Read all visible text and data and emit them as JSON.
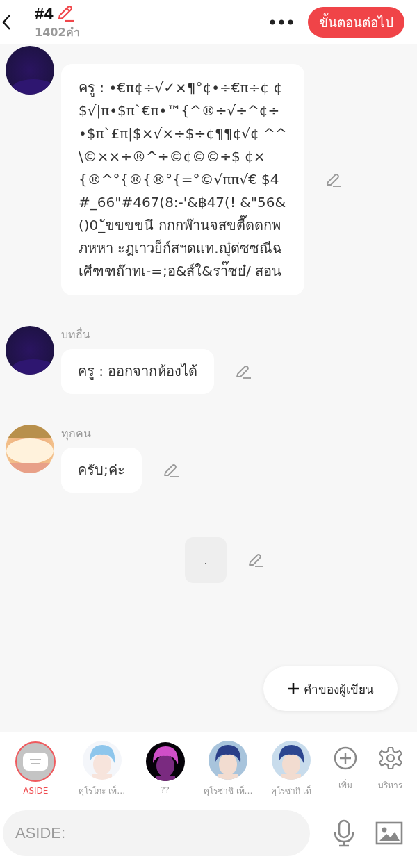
{
  "header": {
    "title": "#4",
    "word_count": "1402คำ",
    "next_button": "ขั้นตอนต่อไป"
  },
  "messages": [
    {
      "kind": "message",
      "text": "ครู : •€π¢÷√✓×¶°¢•÷€π÷¢ ¢$√|π•$π`€π•™{^®÷√÷^¢÷ •$π`£π|$×√×÷$÷¢¶¶¢√¢ ^^\\©××÷®^÷©¢©©÷$ ¢×{®^°{®{®°{=°©√ππ√€ $4#_66\"#467(8:-'&฿47(! &\"56&()0_ัขขขขนึ กกกพ๊านจสขตื๊ดดกพภหหา ะฎเาวย็ก์สฯดแท.ญุ๋ด่ซซณีฉ เศีฑฑถ๊าทเ-=;อ&ส์ใ&รา๊ซย๋/ สอน"
    },
    {
      "kind": "message",
      "sender": "บทอื่น",
      "text": "ครู : ออกจากห้องได้"
    },
    {
      "kind": "message",
      "sender": "ทุกคน",
      "text": "ครับ;ค่ะ"
    },
    {
      "kind": "narration",
      "text": "."
    }
  ],
  "author_note_button": "คำของผู้เขียน",
  "characters": [
    {
      "kind": "aside",
      "name": "ASIDE",
      "selected": true
    },
    {
      "kind": "character",
      "name": "คุโรโกะ เท็…",
      "selected": false
    },
    {
      "kind": "character",
      "name": "??",
      "selected": false
    },
    {
      "kind": "character",
      "name": "คุโรซาชิ เท็…",
      "selected": false
    },
    {
      "kind": "character",
      "name": "คุโรซากิ เท็",
      "selected": false
    },
    {
      "kind": "add",
      "name": "เพิ่ม",
      "selected": false
    },
    {
      "kind": "manage",
      "name": "บริหาร",
      "selected": false
    }
  ],
  "input": {
    "placeholder": "ASIDE:"
  }
}
